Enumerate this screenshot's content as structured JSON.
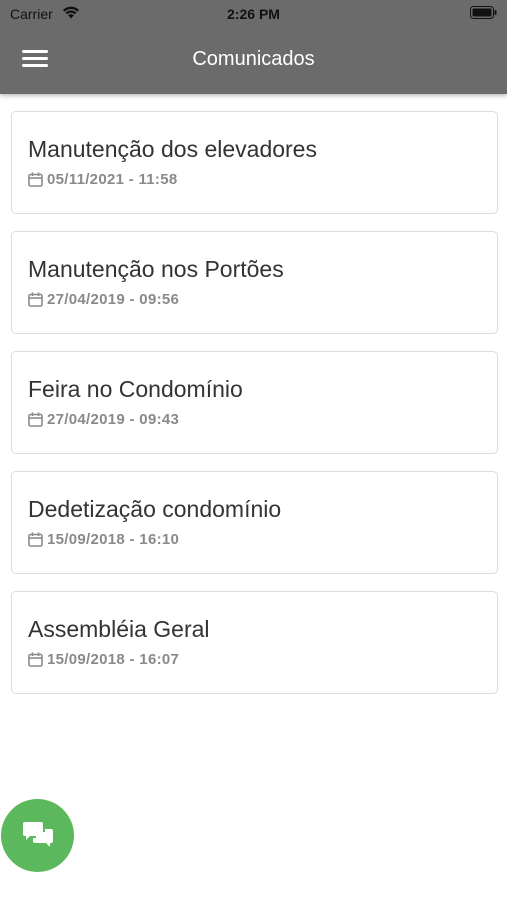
{
  "status_bar": {
    "carrier": "Carrier",
    "time": "2:26 PM",
    "wifi_icon": "wifi-icon",
    "battery_icon": "battery-icon"
  },
  "header": {
    "title": "Comunicados",
    "menu_icon": "hamburger-menu-icon",
    "background": "#6b6b6b"
  },
  "announcements": [
    {
      "title": "Manutenção dos elevadores",
      "date": "05/11/2021 - 11:58"
    },
    {
      "title": "Manutenção nos Portões",
      "date": "27/04/2019 - 09:56"
    },
    {
      "title": "Feira no Condomínio",
      "date": "27/04/2019 - 09:43"
    },
    {
      "title": "Dedetização condomínio",
      "date": "15/09/2018 - 16:10"
    },
    {
      "title": "Assembléia Geral",
      "date": "15/09/2018 - 16:07"
    }
  ],
  "fab": {
    "icon": "chat-icon",
    "color": "#5cb85c"
  }
}
